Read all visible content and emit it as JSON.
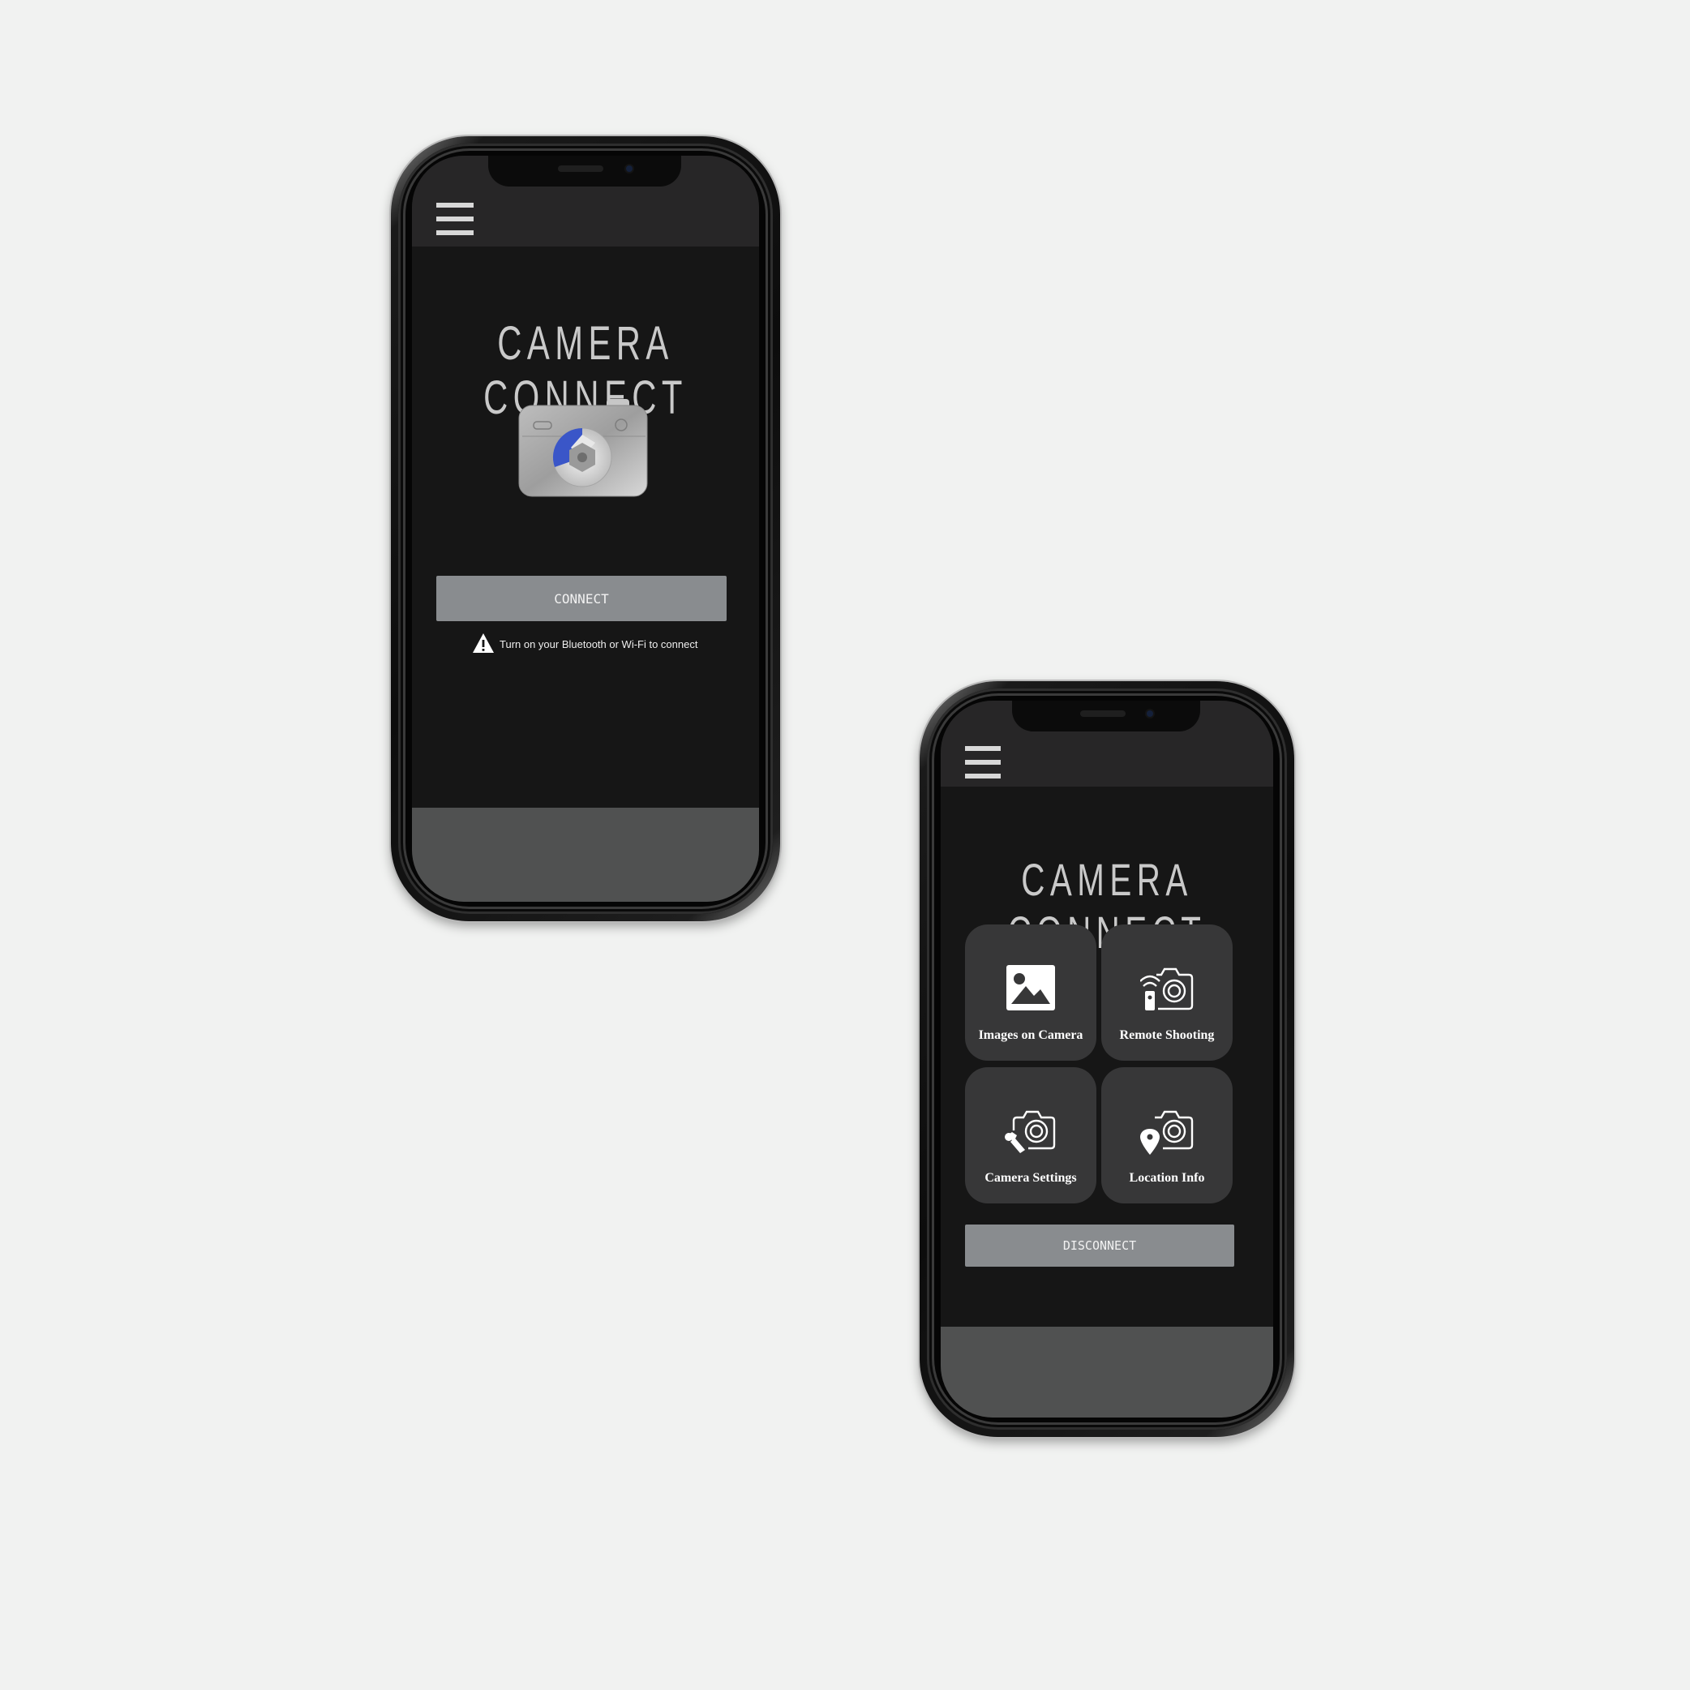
{
  "phone1": {
    "title": "CAMERA CONNECT",
    "connect_label": "CONNECT",
    "warning_text": "Turn on your Bluetooth or Wi-Fi to connect",
    "menu_icon": "hamburger-menu-icon",
    "camera_icon": "camera-app-icon"
  },
  "phone2": {
    "title": "CAMERA CONNECT",
    "tiles": [
      {
        "label": "Images on Camera",
        "icon": "image-icon"
      },
      {
        "label": "Remote Shooting",
        "icon": "remote-camera-icon"
      },
      {
        "label": "Camera Settings",
        "icon": "camera-settings-icon"
      },
      {
        "label": "Location Info",
        "icon": "camera-location-icon"
      }
    ],
    "disconnect_label": "DISCONNECT",
    "menu_icon": "hamburger-menu-icon"
  },
  "colors": {
    "background": "#f1f2f1",
    "screen": "#161616",
    "appbar": "#272627",
    "button": "#898c8f",
    "tile": "#373738",
    "accent_blue": "#3a56c8"
  }
}
